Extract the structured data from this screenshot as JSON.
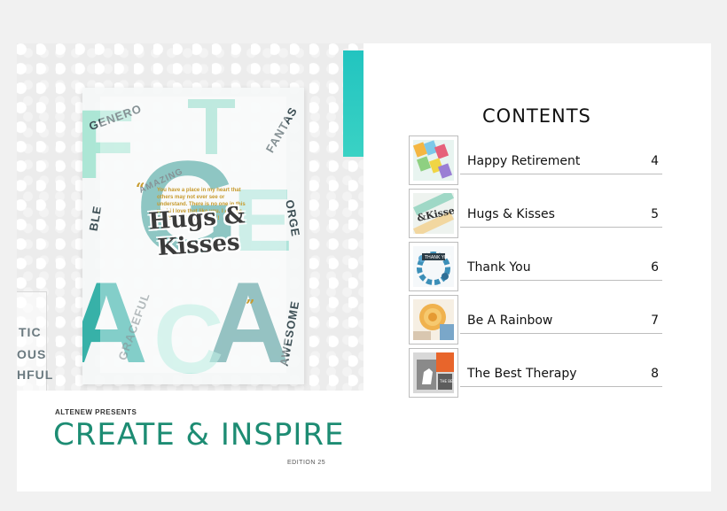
{
  "left_page": {
    "card_title": "Hugs & Kisses",
    "card_sentiment": "You have a place in my heart that others may not ever see or understand. There is no one in this world I love that like you. I always will. YOU'RE AWESOME!",
    "background_words": [
      "GENERO",
      "FANTAS",
      "BLE",
      "AMAZING",
      "ORGE",
      "GRACEFUL",
      "AWESOME",
      "TIC",
      "FUL"
    ],
    "side_words": [
      "TIC",
      "OUS",
      "HFUL"
    ],
    "presents": "ALTENEW PRESENTS",
    "title": "CREATE & INSPIRE",
    "edition": "EDITION 25",
    "colors": {
      "brand_green": "#1d8c73",
      "teal": "#22c4c0",
      "gold": "#c79a2c"
    }
  },
  "right_page": {
    "heading": "CONTENTS",
    "entries": [
      {
        "title": "Happy Retirement",
        "page": "4",
        "thumb_icon": "colorful-letters-card-thumbnail"
      },
      {
        "title": "Hugs & Kisses",
        "page": "5",
        "thumb_icon": "hugs-kisses-card-thumbnail"
      },
      {
        "title": "Thank You",
        "page": "6",
        "thumb_icon": "floral-wreath-card-thumbnail"
      },
      {
        "title": "Be A Rainbow",
        "page": "7",
        "thumb_icon": "yellow-flower-card-thumbnail"
      },
      {
        "title": "The Best Therapy",
        "page": "8",
        "thumb_icon": "horse-card-thumbnail"
      }
    ]
  }
}
